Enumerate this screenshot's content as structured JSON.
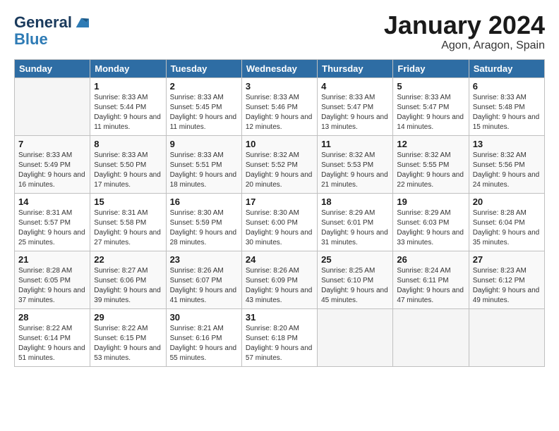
{
  "header": {
    "logo_line1": "General",
    "logo_line2": "Blue",
    "month": "January 2024",
    "location": "Agon, Aragon, Spain"
  },
  "weekdays": [
    "Sunday",
    "Monday",
    "Tuesday",
    "Wednesday",
    "Thursday",
    "Friday",
    "Saturday"
  ],
  "weeks": [
    [
      {
        "day": "",
        "sunrise": "",
        "sunset": "",
        "daylight": "",
        "empty": true
      },
      {
        "day": "1",
        "sunrise": "Sunrise: 8:33 AM",
        "sunset": "Sunset: 5:44 PM",
        "daylight": "Daylight: 9 hours and 11 minutes."
      },
      {
        "day": "2",
        "sunrise": "Sunrise: 8:33 AM",
        "sunset": "Sunset: 5:45 PM",
        "daylight": "Daylight: 9 hours and 11 minutes."
      },
      {
        "day": "3",
        "sunrise": "Sunrise: 8:33 AM",
        "sunset": "Sunset: 5:46 PM",
        "daylight": "Daylight: 9 hours and 12 minutes."
      },
      {
        "day": "4",
        "sunrise": "Sunrise: 8:33 AM",
        "sunset": "Sunset: 5:47 PM",
        "daylight": "Daylight: 9 hours and 13 minutes."
      },
      {
        "day": "5",
        "sunrise": "Sunrise: 8:33 AM",
        "sunset": "Sunset: 5:47 PM",
        "daylight": "Daylight: 9 hours and 14 minutes."
      },
      {
        "day": "6",
        "sunrise": "Sunrise: 8:33 AM",
        "sunset": "Sunset: 5:48 PM",
        "daylight": "Daylight: 9 hours and 15 minutes."
      }
    ],
    [
      {
        "day": "7",
        "sunrise": "Sunrise: 8:33 AM",
        "sunset": "Sunset: 5:49 PM",
        "daylight": "Daylight: 9 hours and 16 minutes."
      },
      {
        "day": "8",
        "sunrise": "Sunrise: 8:33 AM",
        "sunset": "Sunset: 5:50 PM",
        "daylight": "Daylight: 9 hours and 17 minutes."
      },
      {
        "day": "9",
        "sunrise": "Sunrise: 8:33 AM",
        "sunset": "Sunset: 5:51 PM",
        "daylight": "Daylight: 9 hours and 18 minutes."
      },
      {
        "day": "10",
        "sunrise": "Sunrise: 8:32 AM",
        "sunset": "Sunset: 5:52 PM",
        "daylight": "Daylight: 9 hours and 20 minutes."
      },
      {
        "day": "11",
        "sunrise": "Sunrise: 8:32 AM",
        "sunset": "Sunset: 5:53 PM",
        "daylight": "Daylight: 9 hours and 21 minutes."
      },
      {
        "day": "12",
        "sunrise": "Sunrise: 8:32 AM",
        "sunset": "Sunset: 5:55 PM",
        "daylight": "Daylight: 9 hours and 22 minutes."
      },
      {
        "day": "13",
        "sunrise": "Sunrise: 8:32 AM",
        "sunset": "Sunset: 5:56 PM",
        "daylight": "Daylight: 9 hours and 24 minutes."
      }
    ],
    [
      {
        "day": "14",
        "sunrise": "Sunrise: 8:31 AM",
        "sunset": "Sunset: 5:57 PM",
        "daylight": "Daylight: 9 hours and 25 minutes."
      },
      {
        "day": "15",
        "sunrise": "Sunrise: 8:31 AM",
        "sunset": "Sunset: 5:58 PM",
        "daylight": "Daylight: 9 hours and 27 minutes."
      },
      {
        "day": "16",
        "sunrise": "Sunrise: 8:30 AM",
        "sunset": "Sunset: 5:59 PM",
        "daylight": "Daylight: 9 hours and 28 minutes."
      },
      {
        "day": "17",
        "sunrise": "Sunrise: 8:30 AM",
        "sunset": "Sunset: 6:00 PM",
        "daylight": "Daylight: 9 hours and 30 minutes."
      },
      {
        "day": "18",
        "sunrise": "Sunrise: 8:29 AM",
        "sunset": "Sunset: 6:01 PM",
        "daylight": "Daylight: 9 hours and 31 minutes."
      },
      {
        "day": "19",
        "sunrise": "Sunrise: 8:29 AM",
        "sunset": "Sunset: 6:03 PM",
        "daylight": "Daylight: 9 hours and 33 minutes."
      },
      {
        "day": "20",
        "sunrise": "Sunrise: 8:28 AM",
        "sunset": "Sunset: 6:04 PM",
        "daylight": "Daylight: 9 hours and 35 minutes."
      }
    ],
    [
      {
        "day": "21",
        "sunrise": "Sunrise: 8:28 AM",
        "sunset": "Sunset: 6:05 PM",
        "daylight": "Daylight: 9 hours and 37 minutes."
      },
      {
        "day": "22",
        "sunrise": "Sunrise: 8:27 AM",
        "sunset": "Sunset: 6:06 PM",
        "daylight": "Daylight: 9 hours and 39 minutes."
      },
      {
        "day": "23",
        "sunrise": "Sunrise: 8:26 AM",
        "sunset": "Sunset: 6:07 PM",
        "daylight": "Daylight: 9 hours and 41 minutes."
      },
      {
        "day": "24",
        "sunrise": "Sunrise: 8:26 AM",
        "sunset": "Sunset: 6:09 PM",
        "daylight": "Daylight: 9 hours and 43 minutes."
      },
      {
        "day": "25",
        "sunrise": "Sunrise: 8:25 AM",
        "sunset": "Sunset: 6:10 PM",
        "daylight": "Daylight: 9 hours and 45 minutes."
      },
      {
        "day": "26",
        "sunrise": "Sunrise: 8:24 AM",
        "sunset": "Sunset: 6:11 PM",
        "daylight": "Daylight: 9 hours and 47 minutes."
      },
      {
        "day": "27",
        "sunrise": "Sunrise: 8:23 AM",
        "sunset": "Sunset: 6:12 PM",
        "daylight": "Daylight: 9 hours and 49 minutes."
      }
    ],
    [
      {
        "day": "28",
        "sunrise": "Sunrise: 8:22 AM",
        "sunset": "Sunset: 6:14 PM",
        "daylight": "Daylight: 9 hours and 51 minutes."
      },
      {
        "day": "29",
        "sunrise": "Sunrise: 8:22 AM",
        "sunset": "Sunset: 6:15 PM",
        "daylight": "Daylight: 9 hours and 53 minutes."
      },
      {
        "day": "30",
        "sunrise": "Sunrise: 8:21 AM",
        "sunset": "Sunset: 6:16 PM",
        "daylight": "Daylight: 9 hours and 55 minutes."
      },
      {
        "day": "31",
        "sunrise": "Sunrise: 8:20 AM",
        "sunset": "Sunset: 6:18 PM",
        "daylight": "Daylight: 9 hours and 57 minutes."
      },
      {
        "day": "",
        "sunrise": "",
        "sunset": "",
        "daylight": "",
        "empty": true
      },
      {
        "day": "",
        "sunrise": "",
        "sunset": "",
        "daylight": "",
        "empty": true
      },
      {
        "day": "",
        "sunrise": "",
        "sunset": "",
        "daylight": "",
        "empty": true
      }
    ]
  ]
}
